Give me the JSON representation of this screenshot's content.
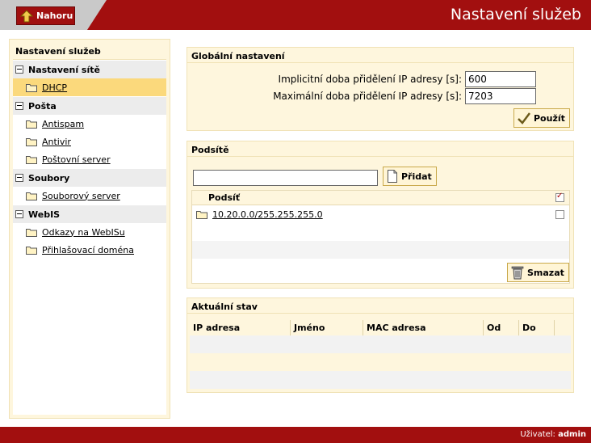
{
  "header": {
    "title": "Nastavení služeb",
    "up_button": "Nahoru"
  },
  "sidebar": {
    "title": "Nastavení služeb",
    "groups": [
      {
        "label": "Nastavení sítě",
        "items": [
          {
            "label": "DHCP",
            "active": true
          }
        ]
      },
      {
        "label": "Pošta",
        "items": [
          {
            "label": "Antispam"
          },
          {
            "label": "Antivir"
          },
          {
            "label": "Poštovní server"
          }
        ]
      },
      {
        "label": "Soubory",
        "items": [
          {
            "label": "Souborový server"
          }
        ]
      },
      {
        "label": "WebIS",
        "items": [
          {
            "label": "Odkazy na WebISu"
          },
          {
            "label": "Přihlašovací doména"
          }
        ]
      }
    ]
  },
  "global": {
    "title": "Globální nastavení",
    "default_lease_label": "Implicitní doba přidělení IP adresy [s]:",
    "default_lease_value": "600",
    "max_lease_label": "Maximální doba přidělení IP adresy [s]:",
    "max_lease_value": "7203",
    "apply_button": "Použít"
  },
  "subnets": {
    "title": "Podsítě",
    "input_value": "",
    "add_button": "Přidat",
    "column_subnet": "Podsíť",
    "rows": [
      {
        "subnet": "10.20.0.0/255.255.255.0",
        "checked": false
      }
    ],
    "delete_button": "Smazat"
  },
  "status": {
    "title": "Aktuální stav",
    "columns": [
      "IP adresa",
      "Jméno",
      "MAC adresa",
      "Od",
      "Do"
    ]
  },
  "footer": {
    "user_label": "Uživatel:",
    "user_name": "admin"
  },
  "colors": {
    "brand": "#a20f0f",
    "panel": "#fef6dd",
    "active": "#fbd97c"
  }
}
